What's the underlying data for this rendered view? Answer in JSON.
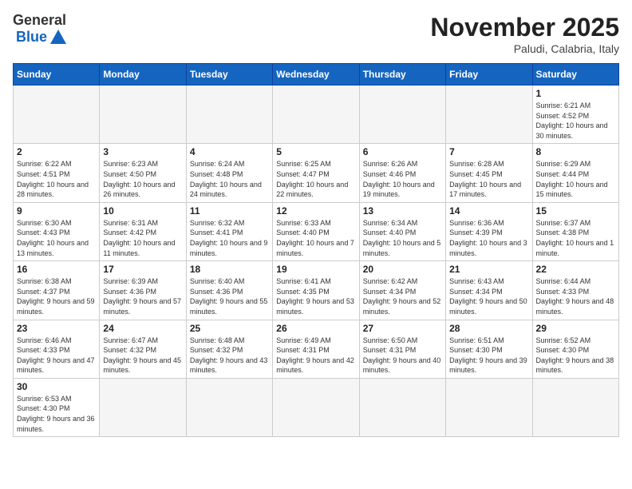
{
  "header": {
    "logo_text_black": "General",
    "logo_text_blue": "Blue",
    "title": "November 2025",
    "subtitle": "Paludi, Calabria, Italy"
  },
  "calendar": {
    "days_of_week": [
      "Sunday",
      "Monday",
      "Tuesday",
      "Wednesday",
      "Thursday",
      "Friday",
      "Saturday"
    ],
    "weeks": [
      [
        {
          "day": "",
          "info": ""
        },
        {
          "day": "",
          "info": ""
        },
        {
          "day": "",
          "info": ""
        },
        {
          "day": "",
          "info": ""
        },
        {
          "day": "",
          "info": ""
        },
        {
          "day": "",
          "info": ""
        },
        {
          "day": "1",
          "info": "Sunrise: 6:21 AM\nSunset: 4:52 PM\nDaylight: 10 hours and 30 minutes."
        }
      ],
      [
        {
          "day": "2",
          "info": "Sunrise: 6:22 AM\nSunset: 4:51 PM\nDaylight: 10 hours and 28 minutes."
        },
        {
          "day": "3",
          "info": "Sunrise: 6:23 AM\nSunset: 4:50 PM\nDaylight: 10 hours and 26 minutes."
        },
        {
          "day": "4",
          "info": "Sunrise: 6:24 AM\nSunset: 4:48 PM\nDaylight: 10 hours and 24 minutes."
        },
        {
          "day": "5",
          "info": "Sunrise: 6:25 AM\nSunset: 4:47 PM\nDaylight: 10 hours and 22 minutes."
        },
        {
          "day": "6",
          "info": "Sunrise: 6:26 AM\nSunset: 4:46 PM\nDaylight: 10 hours and 19 minutes."
        },
        {
          "day": "7",
          "info": "Sunrise: 6:28 AM\nSunset: 4:45 PM\nDaylight: 10 hours and 17 minutes."
        },
        {
          "day": "8",
          "info": "Sunrise: 6:29 AM\nSunset: 4:44 PM\nDaylight: 10 hours and 15 minutes."
        }
      ],
      [
        {
          "day": "9",
          "info": "Sunrise: 6:30 AM\nSunset: 4:43 PM\nDaylight: 10 hours and 13 minutes."
        },
        {
          "day": "10",
          "info": "Sunrise: 6:31 AM\nSunset: 4:42 PM\nDaylight: 10 hours and 11 minutes."
        },
        {
          "day": "11",
          "info": "Sunrise: 6:32 AM\nSunset: 4:41 PM\nDaylight: 10 hours and 9 minutes."
        },
        {
          "day": "12",
          "info": "Sunrise: 6:33 AM\nSunset: 4:40 PM\nDaylight: 10 hours and 7 minutes."
        },
        {
          "day": "13",
          "info": "Sunrise: 6:34 AM\nSunset: 4:40 PM\nDaylight: 10 hours and 5 minutes."
        },
        {
          "day": "14",
          "info": "Sunrise: 6:36 AM\nSunset: 4:39 PM\nDaylight: 10 hours and 3 minutes."
        },
        {
          "day": "15",
          "info": "Sunrise: 6:37 AM\nSunset: 4:38 PM\nDaylight: 10 hours and 1 minute."
        }
      ],
      [
        {
          "day": "16",
          "info": "Sunrise: 6:38 AM\nSunset: 4:37 PM\nDaylight: 9 hours and 59 minutes."
        },
        {
          "day": "17",
          "info": "Sunrise: 6:39 AM\nSunset: 4:36 PM\nDaylight: 9 hours and 57 minutes."
        },
        {
          "day": "18",
          "info": "Sunrise: 6:40 AM\nSunset: 4:36 PM\nDaylight: 9 hours and 55 minutes."
        },
        {
          "day": "19",
          "info": "Sunrise: 6:41 AM\nSunset: 4:35 PM\nDaylight: 9 hours and 53 minutes."
        },
        {
          "day": "20",
          "info": "Sunrise: 6:42 AM\nSunset: 4:34 PM\nDaylight: 9 hours and 52 minutes."
        },
        {
          "day": "21",
          "info": "Sunrise: 6:43 AM\nSunset: 4:34 PM\nDaylight: 9 hours and 50 minutes."
        },
        {
          "day": "22",
          "info": "Sunrise: 6:44 AM\nSunset: 4:33 PM\nDaylight: 9 hours and 48 minutes."
        }
      ],
      [
        {
          "day": "23",
          "info": "Sunrise: 6:46 AM\nSunset: 4:33 PM\nDaylight: 9 hours and 47 minutes."
        },
        {
          "day": "24",
          "info": "Sunrise: 6:47 AM\nSunset: 4:32 PM\nDaylight: 9 hours and 45 minutes."
        },
        {
          "day": "25",
          "info": "Sunrise: 6:48 AM\nSunset: 4:32 PM\nDaylight: 9 hours and 43 minutes."
        },
        {
          "day": "26",
          "info": "Sunrise: 6:49 AM\nSunset: 4:31 PM\nDaylight: 9 hours and 42 minutes."
        },
        {
          "day": "27",
          "info": "Sunrise: 6:50 AM\nSunset: 4:31 PM\nDaylight: 9 hours and 40 minutes."
        },
        {
          "day": "28",
          "info": "Sunrise: 6:51 AM\nSunset: 4:30 PM\nDaylight: 9 hours and 39 minutes."
        },
        {
          "day": "29",
          "info": "Sunrise: 6:52 AM\nSunset: 4:30 PM\nDaylight: 9 hours and 38 minutes."
        }
      ],
      [
        {
          "day": "30",
          "info": "Sunrise: 6:53 AM\nSunset: 4:30 PM\nDaylight: 9 hours and 36 minutes."
        },
        {
          "day": "",
          "info": ""
        },
        {
          "day": "",
          "info": ""
        },
        {
          "day": "",
          "info": ""
        },
        {
          "day": "",
          "info": ""
        },
        {
          "day": "",
          "info": ""
        },
        {
          "day": "",
          "info": ""
        }
      ]
    ]
  }
}
